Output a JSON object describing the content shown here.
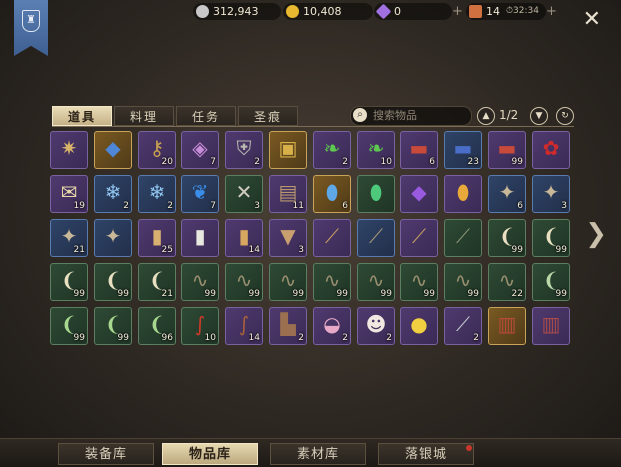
{
  "header": {
    "silver": "312,943",
    "gold": "10,408",
    "gems": "0",
    "stamina": "14",
    "timer": "32:34"
  },
  "tabs": [
    "道具",
    "料理",
    "任务",
    "圣痕"
  ],
  "search": {
    "placeholder": "搜索物品"
  },
  "pager": {
    "text": "1/2"
  },
  "bottom_tabs": [
    "装备库",
    "物品库",
    "素材库",
    "落银城"
  ],
  "icons": {
    "close": "close-icon",
    "search": "search-icon",
    "prev": "chevron-up-icon",
    "next": "chevron-down-icon",
    "refresh": "refresh-icon",
    "next_page": "chevron-right-icon"
  },
  "colors": {
    "purple": "#4f3a6e",
    "gold": "#c9a357",
    "blue": "#2f4468",
    "green": "#2e4a35",
    "active_tab": "#e9dcb6"
  },
  "grid": [
    [
      {
        "name": "compass-charm",
        "glyph": "✷",
        "color": "#d8b46a",
        "rarity": "purple",
        "count": ""
      },
      {
        "name": "blue-ticket",
        "glyph": "◆",
        "color": "#4e86d8",
        "rarity": "gold",
        "count": ""
      },
      {
        "name": "bronze-key",
        "glyph": "⚷",
        "color": "#c9a050",
        "rarity": "purple",
        "count": "20"
      },
      {
        "name": "rune-box",
        "glyph": "◈",
        "color": "#c88cd8",
        "rarity": "purple",
        "count": "7"
      },
      {
        "name": "knight-shield",
        "glyph": "⛨",
        "color": "#b8b8b0",
        "rarity": "purple",
        "count": "2"
      },
      {
        "name": "treasure-chest",
        "glyph": "▣",
        "color": "#d8b04a",
        "rarity": "gold",
        "count": ""
      },
      {
        "name": "green-feather",
        "glyph": "❧",
        "color": "#5ec84e",
        "rarity": "purple",
        "count": "2"
      },
      {
        "name": "green-feather",
        "glyph": "❧",
        "color": "#5ec84e",
        "rarity": "purple",
        "count": "10"
      },
      {
        "name": "red-voucher",
        "glyph": "▬",
        "color": "#c84a3a",
        "rarity": "purple",
        "count": "6"
      },
      {
        "name": "blue-voucher",
        "glyph": "▬",
        "color": "#4a6ec8",
        "rarity": "blue",
        "count": "23"
      },
      {
        "name": "red-voucher",
        "glyph": "▬",
        "color": "#c84a3a",
        "rarity": "purple",
        "count": "99"
      },
      {
        "name": "red-rose",
        "glyph": "✿",
        "color": "#d02a2a",
        "rarity": "purple",
        "count": ""
      }
    ],
    [
      {
        "name": "sealed-letter",
        "glyph": "✉",
        "color": "#e8d8a8",
        "rarity": "purple",
        "count": "19"
      },
      {
        "name": "ice-crystal",
        "glyph": "❄",
        "color": "#8fc4ee",
        "rarity": "blue",
        "count": "2"
      },
      {
        "name": "ice-crystal",
        "glyph": "❄",
        "color": "#8fc4ee",
        "rarity": "blue",
        "count": "2"
      },
      {
        "name": "blue-butterfly",
        "glyph": "❦",
        "color": "#3a8ee8",
        "rarity": "blue",
        "count": "7"
      },
      {
        "name": "crossed-parcel",
        "glyph": "✕",
        "color": "#d0ccc0",
        "rarity": "green",
        "count": "3"
      },
      {
        "name": "backpack",
        "glyph": "▤",
        "color": "#b89870",
        "rarity": "purple",
        "count": "11"
      },
      {
        "name": "blue-gem",
        "glyph": "⬮",
        "color": "#5ea8e8",
        "rarity": "gold",
        "count": "6"
      },
      {
        "name": "green-gem",
        "glyph": "⬮",
        "color": "#4ec87a",
        "rarity": "green",
        "count": ""
      },
      {
        "name": "purple-crystal",
        "glyph": "◆",
        "color": "#9a5ae0",
        "rarity": "purple",
        "count": ""
      },
      {
        "name": "amber-gem",
        "glyph": "⬮",
        "color": "#e8a83a",
        "rarity": "purple",
        "count": ""
      },
      {
        "name": "torn-scroll",
        "glyph": "✦",
        "color": "#c8b898",
        "rarity": "blue",
        "count": "6"
      },
      {
        "name": "torn-scroll",
        "glyph": "✦",
        "color": "#c8b898",
        "rarity": "blue",
        "count": "3"
      }
    ],
    [
      {
        "name": "torn-scroll",
        "glyph": "✦",
        "color": "#c8b898",
        "rarity": "blue",
        "count": "21"
      },
      {
        "name": "torn-scroll",
        "glyph": "✦",
        "color": "#c8b898",
        "rarity": "blue",
        "count": ""
      },
      {
        "name": "wood-log",
        "glyph": "▮",
        "color": "#d8b070",
        "rarity": "purple",
        "count": "25"
      },
      {
        "name": "white-cylinder",
        "glyph": "▮",
        "color": "#e8e8e0",
        "rarity": "purple",
        "count": ""
      },
      {
        "name": "wood-log",
        "glyph": "▮",
        "color": "#d8a860",
        "rarity": "purple",
        "count": "14"
      },
      {
        "name": "cloth-pouch",
        "glyph": "▼",
        "color": "#c8a070",
        "rarity": "purple",
        "count": "3"
      },
      {
        "name": "fishing-rod",
        "glyph": "⟋",
        "color": "#c8a060",
        "rarity": "purple",
        "count": ""
      },
      {
        "name": "fishing-rod",
        "glyph": "⟋",
        "color": "#a89878",
        "rarity": "blue",
        "count": ""
      },
      {
        "name": "fishing-rod",
        "glyph": "⟋",
        "color": "#c8a060",
        "rarity": "purple",
        "count": ""
      },
      {
        "name": "fishing-rod",
        "glyph": "⟋",
        "color": "#8a9878",
        "rarity": "green",
        "count": ""
      },
      {
        "name": "bait-grub",
        "glyph": "❨",
        "color": "#e8e0c0",
        "rarity": "green",
        "count": "99"
      },
      {
        "name": "bait-grub",
        "glyph": "❨",
        "color": "#e8e0c0",
        "rarity": "green",
        "count": "99"
      }
    ],
    [
      {
        "name": "bait-grub",
        "glyph": "❨",
        "color": "#e8e0c0",
        "rarity": "green",
        "count": "99"
      },
      {
        "name": "bait-grub",
        "glyph": "❨",
        "color": "#e8e0c0",
        "rarity": "green",
        "count": "99"
      },
      {
        "name": "bait-grub",
        "glyph": "❨",
        "color": "#e8e0c0",
        "rarity": "green",
        "count": "21"
      },
      {
        "name": "worm-bait",
        "glyph": "∿",
        "color": "#9a9070",
        "rarity": "green",
        "count": "99"
      },
      {
        "name": "worm-bait",
        "glyph": "∿",
        "color": "#9a9070",
        "rarity": "green",
        "count": "99"
      },
      {
        "name": "worm-bait",
        "glyph": "∿",
        "color": "#9a9070",
        "rarity": "green",
        "count": "99"
      },
      {
        "name": "worm-bait",
        "glyph": "∿",
        "color": "#9a9070",
        "rarity": "green",
        "count": "99"
      },
      {
        "name": "worm-bait",
        "glyph": "∿",
        "color": "#9a9070",
        "rarity": "green",
        "count": "99"
      },
      {
        "name": "worm-bait",
        "glyph": "∿",
        "color": "#9a9070",
        "rarity": "green",
        "count": "99"
      },
      {
        "name": "worm-bait",
        "glyph": "∿",
        "color": "#9a9070",
        "rarity": "green",
        "count": "99"
      },
      {
        "name": "worm-bait",
        "glyph": "∿",
        "color": "#9a9070",
        "rarity": "green",
        "count": "22"
      },
      {
        "name": "bait-grub",
        "glyph": "❨",
        "color": "#b8d8a8",
        "rarity": "green",
        "count": "99"
      }
    ],
    [
      {
        "name": "green-grub",
        "glyph": "❨",
        "color": "#a8d890",
        "rarity": "green",
        "count": "99"
      },
      {
        "name": "green-grub",
        "glyph": "❨",
        "color": "#a8d890",
        "rarity": "green",
        "count": "99"
      },
      {
        "name": "green-grub",
        "glyph": "❨",
        "color": "#a8d890",
        "rarity": "green",
        "count": "96"
      },
      {
        "name": "red-worm",
        "glyph": "∫",
        "color": "#d03a2a",
        "rarity": "green",
        "count": "10"
      },
      {
        "name": "brown-worm",
        "glyph": "∫",
        "color": "#a8603a",
        "rarity": "purple",
        "count": "14"
      },
      {
        "name": "leather-boot",
        "glyph": "▙",
        "color": "#9a7050",
        "rarity": "purple",
        "count": "2"
      },
      {
        "name": "seashell",
        "glyph": "◒",
        "color": "#e8a8c8",
        "rarity": "purple",
        "count": "2"
      },
      {
        "name": "lucky-cat",
        "glyph": "☻",
        "color": "#f0e8e0",
        "rarity": "purple",
        "count": "2"
      },
      {
        "name": "yellow-chick",
        "glyph": "●",
        "color": "#f0d040",
        "rarity": "purple",
        "count": ""
      },
      {
        "name": "steel-dagger",
        "glyph": "⟋",
        "color": "#c8ccd0",
        "rarity": "purple",
        "count": "2"
      },
      {
        "name": "red-tome",
        "glyph": "▥",
        "color": "#b84a3a",
        "rarity": "gold",
        "count": ""
      },
      {
        "name": "red-tome",
        "glyph": "▥",
        "color": "#a84a4a",
        "rarity": "purple",
        "count": ""
      }
    ]
  ]
}
